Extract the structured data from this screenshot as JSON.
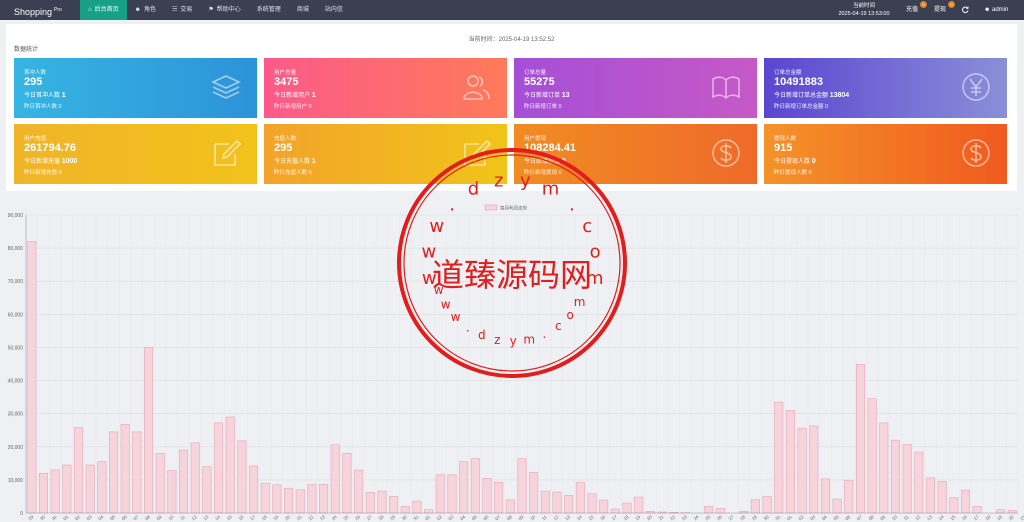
{
  "header": {
    "brand": "Shopping",
    "brand_sup": "Pro",
    "nav": [
      {
        "label": "后台首页",
        "icon": "home-icon",
        "active": true
      },
      {
        "label": "角色",
        "icon": "user-icon",
        "active": false
      },
      {
        "label": "交易",
        "icon": "cart-icon",
        "active": false
      },
      {
        "label": "帮助中心",
        "icon": "flag-icon",
        "active": false
      },
      {
        "label": "系统管理",
        "icon": "",
        "active": false
      },
      {
        "label": "商城",
        "icon": "",
        "active": false
      },
      {
        "label": "站内信",
        "icon": "",
        "active": false
      }
    ],
    "time_label": "当前时间",
    "time_value": "2025-04-19 13:53:00",
    "recharge": "充值",
    "recharge_badge": "0",
    "withdraw": "提现",
    "withdraw_badge": "0",
    "refresh_icon": "refresh-icon",
    "user": "admin"
  },
  "main": {
    "stat_time": "当前时间：2025-04-19 13:52:52",
    "section_title": "数据统计"
  },
  "cards": [
    {
      "title": "首冲人数",
      "value": "295",
      "sub1_label": "今日首冲人数",
      "sub1_value": "1",
      "sub2": "昨日首冲人数 0",
      "icon": "layers-icon",
      "from": "#36b5e2",
      "to": "#2c93d8"
    },
    {
      "title": "用户总量",
      "value": "3475",
      "sub1_label": "今日新增用户",
      "sub1_value": "1",
      "sub2": "昨日新增用户 0",
      "icon": "users-icon",
      "from": "#fb5a8a",
      "to": "#ff7a59"
    },
    {
      "title": "订单总量",
      "value": "55275",
      "sub1_label": "今日新增订单",
      "sub1_value": "13",
      "sub2": "昨日新增订单 0",
      "icon": "book-icon",
      "from": "#a54fd6",
      "to": "#c659c6"
    },
    {
      "title": "订单总金额",
      "value": "10491883",
      "sub1_label": "今日新增订单总金额",
      "sub1_value": "13804",
      "sub2": "昨日新增订单总金额 0",
      "icon": "yen-icon",
      "from": "#5b46d1",
      "to": "#8a8fd8"
    },
    {
      "title": "用户充值",
      "value": "261794.76",
      "sub1_label": "今日新增充值",
      "sub1_value": "1000",
      "sub2": "昨日新增充值 0",
      "icon": "edit-icon",
      "from": "#f0b429",
      "to": "#f2c21a"
    },
    {
      "title": "充值人数",
      "value": "295",
      "sub1_label": "今日充值人数",
      "sub1_value": "1",
      "sub2": "昨日充值人数 0",
      "icon": "edit-icon",
      "from": "#f3a32a",
      "to": "#f0c419"
    },
    {
      "title": "用户提现",
      "value": "108284.41",
      "sub1_label": "今日新增提现",
      "sub1_value": "0",
      "sub2": "昨日新增提现 0",
      "icon": "dollar-icon",
      "from": "#f08c22",
      "to": "#ef6a2a"
    },
    {
      "title": "提现人数",
      "value": "915",
      "sub1_label": "今日提现人数",
      "sub1_value": "0",
      "sub2": "昨日提现人数 0",
      "icon": "dollar-icon",
      "from": "#f4932a",
      "to": "#f05a1e"
    }
  ],
  "chart_data": {
    "type": "bar",
    "legend": "每月利润走势",
    "ylim": [
      0,
      90000
    ],
    "yticks": [
      "0",
      "10,000",
      "20,000",
      "30,000",
      "40,000",
      "50,000",
      "60,000",
      "70,000",
      "80,000",
      "90,000"
    ],
    "grid": true,
    "bar_color": "#f7d4dc",
    "bar_border": "#e7a6b5",
    "categories": [
      "29",
      "30",
      "31",
      "01",
      "02",
      "03",
      "04",
      "05",
      "06",
      "07",
      "08",
      "09",
      "10",
      "11",
      "12",
      "13",
      "14",
      "15",
      "16",
      "17",
      "18",
      "19",
      "20",
      "21",
      "22",
      "23",
      "24",
      "25",
      "26",
      "27",
      "28",
      "29",
      "30",
      "31",
      "01",
      "02",
      "03",
      "04",
      "05",
      "06",
      "07",
      "08",
      "09",
      "10",
      "11",
      "12",
      "13",
      "14",
      "15",
      "16",
      "17",
      "18",
      "19",
      "20",
      "21",
      "22",
      "23",
      "24",
      "25",
      "26",
      "27",
      "28",
      "29",
      "30",
      "31",
      "01",
      "02",
      "03",
      "04",
      "05",
      "06",
      "07",
      "08",
      "09",
      "10",
      "11",
      "12",
      "13",
      "14",
      "15",
      "16",
      "17",
      "18",
      "19",
      "20",
      "21",
      "22",
      "23",
      "24",
      "25",
      "26",
      "27",
      "28",
      "29",
      "30",
      "31",
      "01",
      "02",
      "03",
      "04",
      "05",
      "06",
      "07",
      "08",
      "09",
      "10",
      "11",
      "12",
      "13",
      "14",
      "15",
      "16",
      "17",
      "18",
      "19",
      "20",
      "21"
    ],
    "values": [
      82000,
      12000,
      13000,
      14500,
      25800,
      14500,
      15500,
      24500,
      26800,
      24500,
      50000,
      18000,
      12800,
      19000,
      21200,
      14000,
      27200,
      29000,
      21800,
      14200,
      9000,
      8500,
      7500,
      7000,
      8600,
      8600,
      20600,
      18000,
      13000,
      6200,
      6600,
      5000,
      2000,
      3600,
      1000,
      11600,
      11500,
      15500,
      16400,
      10500,
      9300,
      4000,
      16400,
      12300,
      6600,
      6300,
      5300,
      9200,
      5800,
      3900,
      1200,
      3000,
      4800,
      500,
      300,
      200,
      100,
      0,
      2000,
      1400,
      0,
      500,
      4000,
      5000,
      33500,
      31000,
      25600,
      26300,
      10300,
      4200,
      9900,
      44900,
      34500,
      27200,
      22000,
      20700,
      18400,
      10600,
      9500,
      4600,
      6900,
      2000,
      0,
      1000,
      800
    ]
  },
  "watermark": {
    "center_text": "道臻源码网",
    "url": "www.dzym.com"
  }
}
